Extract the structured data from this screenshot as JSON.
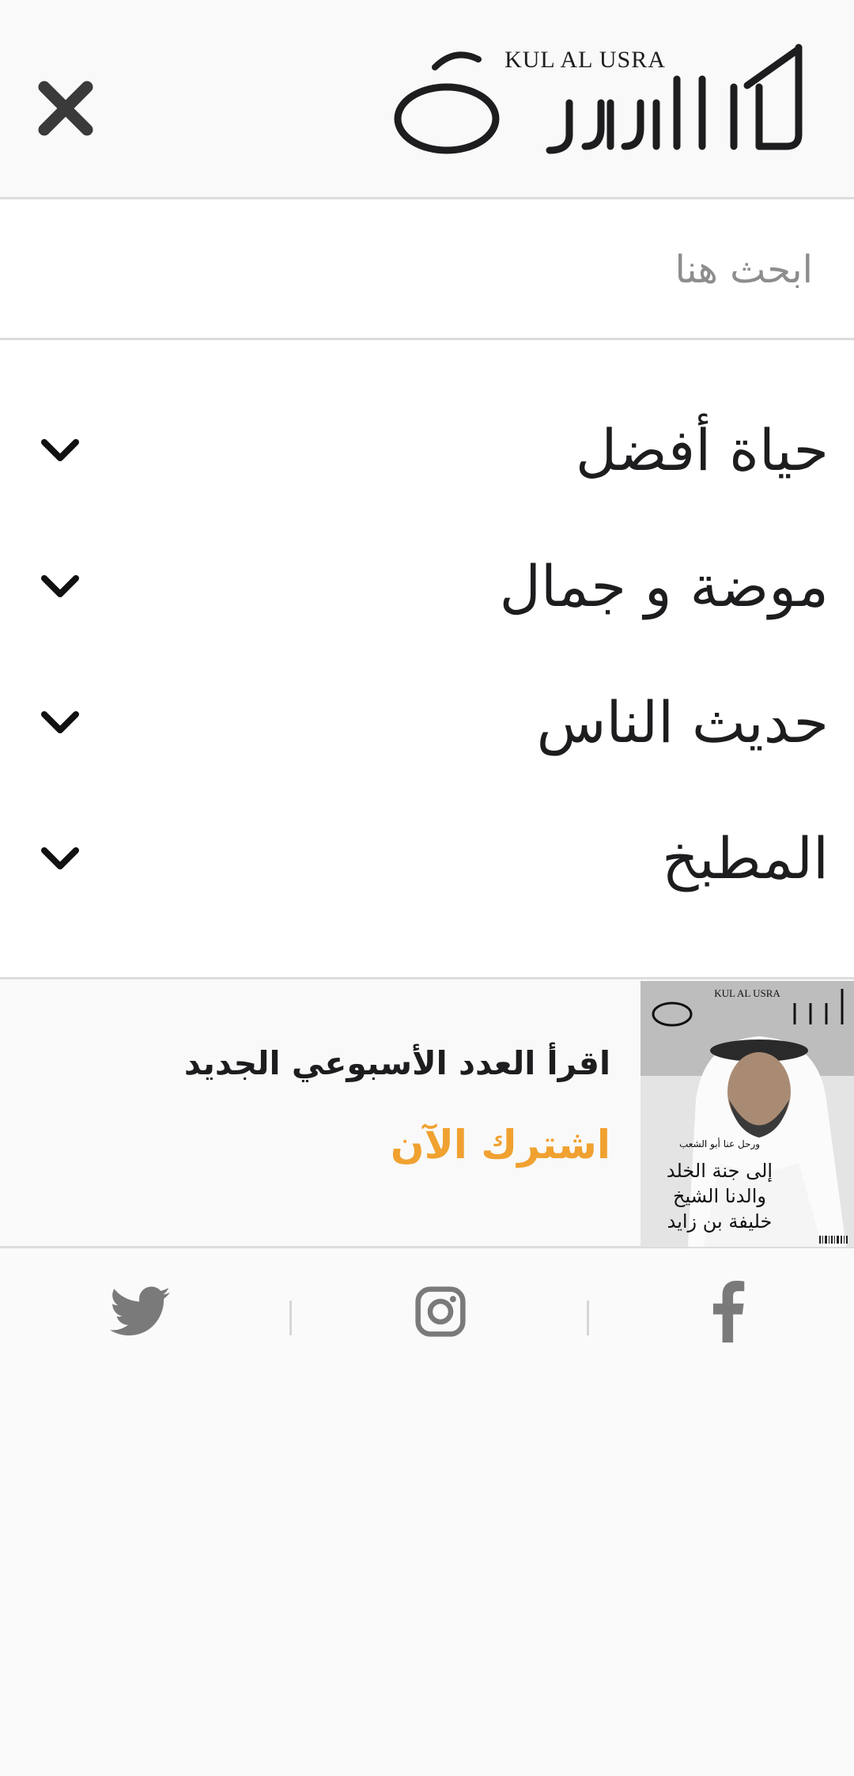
{
  "header": {
    "brand_latin": "KUL AL USRA",
    "close_icon": "close-icon"
  },
  "search": {
    "placeholder": "ابحث هنا"
  },
  "menu": {
    "items": [
      {
        "label": "حياة أفضل",
        "icon": "chevron-down-icon"
      },
      {
        "label": "موضة و جمال",
        "icon": "chevron-down-icon"
      },
      {
        "label": "حديث الناس",
        "icon": "chevron-down-icon"
      },
      {
        "label": "المطبخ",
        "icon": "chevron-down-icon"
      }
    ]
  },
  "promo": {
    "title": "اقرأ العدد الأسبوعي الجديد",
    "cta": "اشترك الآن",
    "cta_color": "#f0a130",
    "cover": {
      "brand_latin": "KUL AL USRA",
      "small_line": "ورحل عنا أبو الشعب",
      "headline_lines": [
        "إلى جنة الخلد",
        "والدنا الشيخ",
        "خليفة بن زايد"
      ]
    }
  },
  "social": {
    "icons": [
      "twitter-icon",
      "instagram-icon",
      "facebook-icon"
    ],
    "icon_color": "#7a7a7a"
  }
}
